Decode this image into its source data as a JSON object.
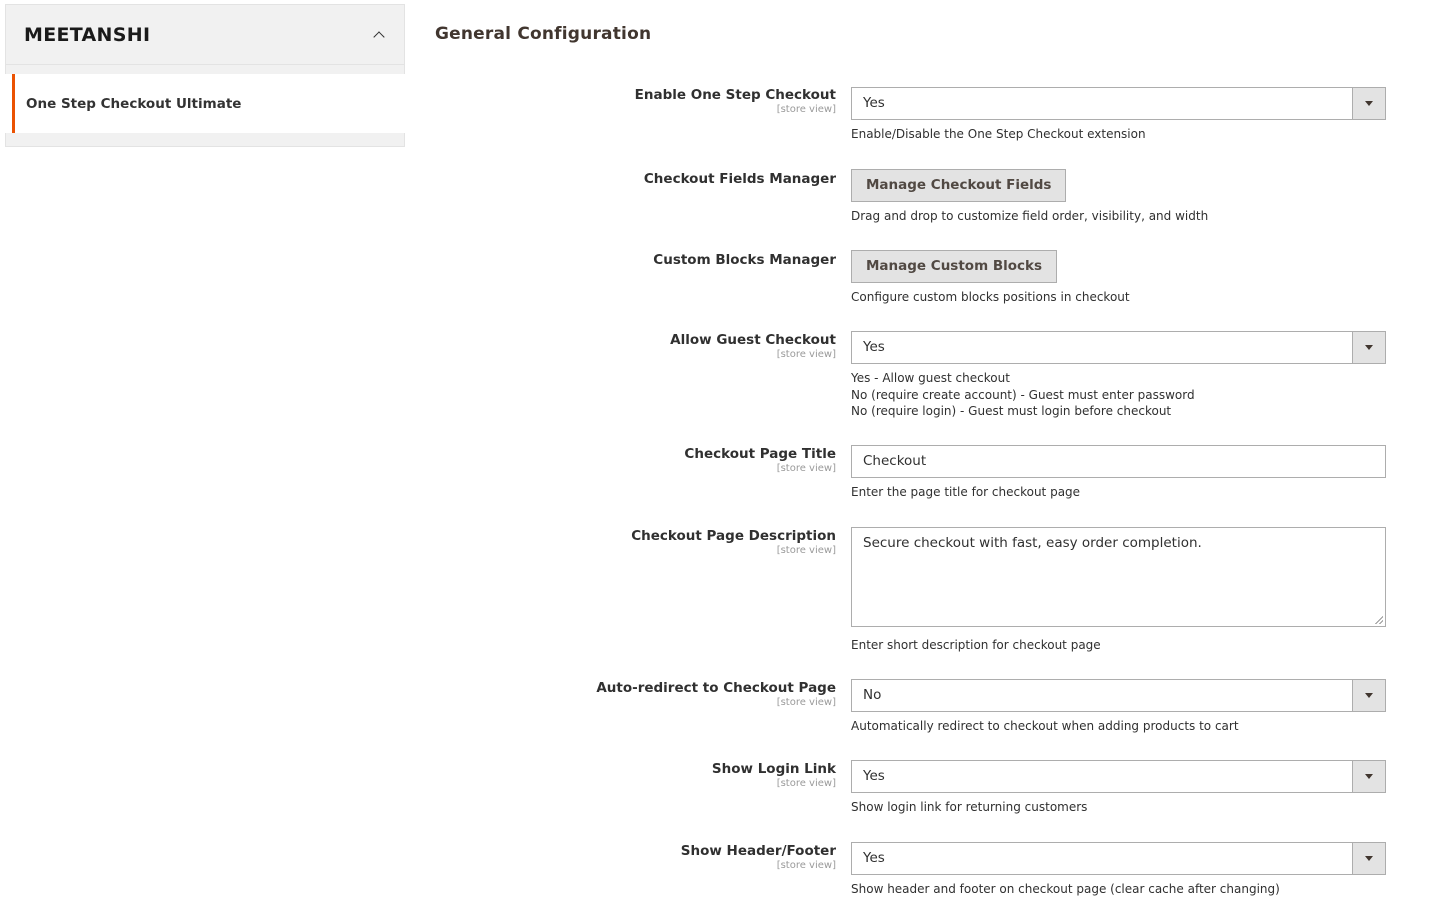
{
  "sidebar": {
    "brand": "MEETANSHI",
    "items": [
      {
        "label": "One Step Checkout Ultimate",
        "active": true
      }
    ]
  },
  "main": {
    "section_title": "General Configuration",
    "fields": {
      "enable": {
        "label": "Enable One Step Checkout",
        "scope": "[store view]",
        "value": "Yes",
        "note": "Enable/Disable the One Step Checkout extension"
      },
      "fields_manager": {
        "label": "Checkout Fields Manager",
        "button": "Manage Checkout Fields",
        "note": "Drag and drop to customize field order, visibility, and width"
      },
      "blocks_manager": {
        "label": "Custom Blocks Manager",
        "button": "Manage Custom Blocks",
        "note": "Configure custom blocks positions in checkout"
      },
      "guest": {
        "label": "Allow Guest Checkout",
        "scope": "[store view]",
        "value": "Yes",
        "note_lines": [
          "Yes - Allow guest checkout",
          "No (require create account) - Guest must enter password",
          "No (require login) - Guest must login before checkout"
        ]
      },
      "page_title": {
        "label": "Checkout Page Title",
        "scope": "[store view]",
        "value": "Checkout",
        "note": "Enter the page title for checkout page"
      },
      "page_desc": {
        "label": "Checkout Page Description",
        "scope": "[store view]",
        "value": "Secure checkout with fast, easy order completion.",
        "note": "Enter short description for checkout page"
      },
      "redirect": {
        "label": "Auto-redirect to Checkout Page",
        "scope": "[store view]",
        "value": "No",
        "note": "Automatically redirect to checkout when adding products to cart"
      },
      "login_link": {
        "label": "Show Login Link",
        "scope": "[store view]",
        "value": "Yes",
        "note": "Show login link for returning customers"
      },
      "header_footer": {
        "label": "Show Header/Footer",
        "scope": "[store view]",
        "value": "Yes",
        "note": "Show header and footer on checkout page (clear cache after changing)"
      }
    }
  },
  "colors": {
    "accent": "#eb5202",
    "sidebar_bg": "#f1f1f1",
    "button_bg": "#e3e3e3"
  },
  "icons": {
    "collapse": "chevron-up-icon",
    "select_arrow": "caret-down-icon"
  }
}
